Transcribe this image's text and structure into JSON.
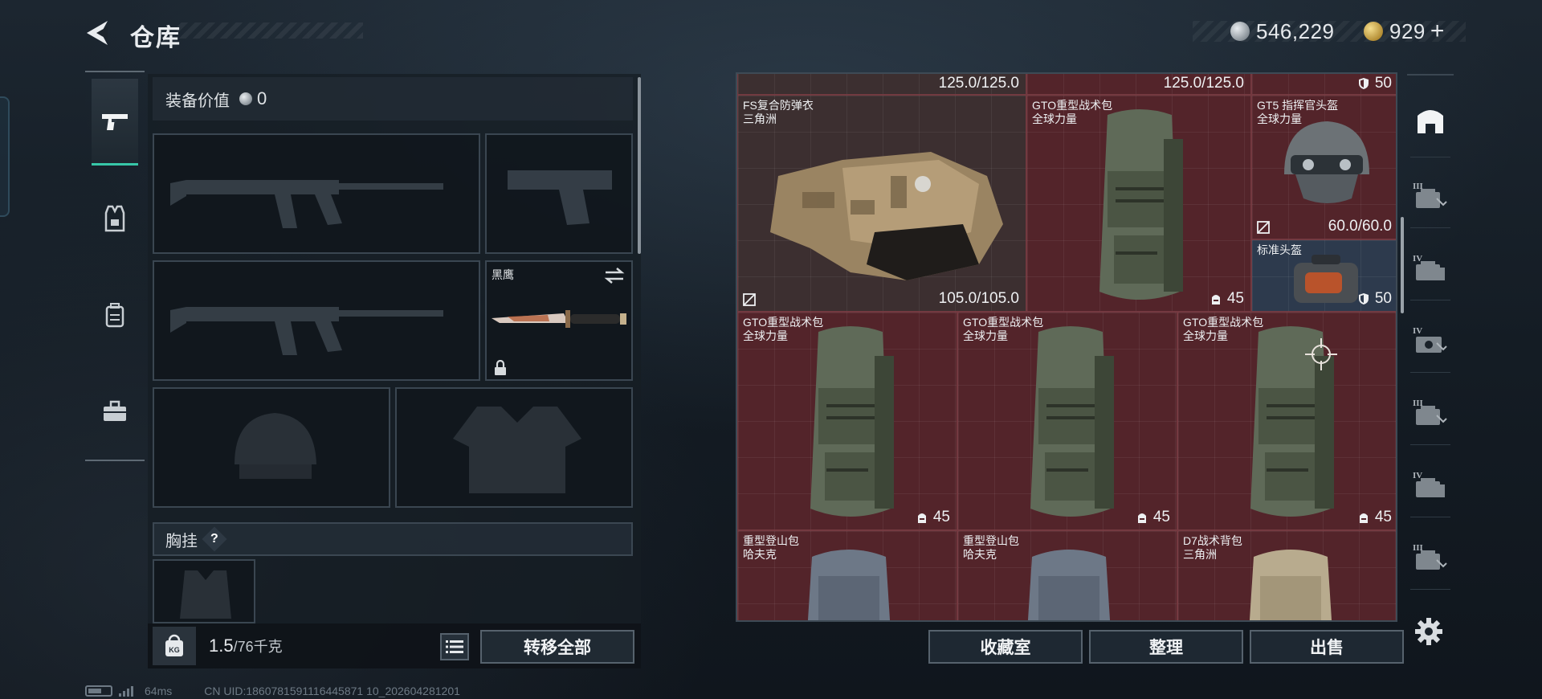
{
  "header": {
    "title": "仓库"
  },
  "currency": {
    "silver_amount": "546,229",
    "gold_amount": "929",
    "gold_add": "+"
  },
  "equipment": {
    "value_label": "装备价值",
    "value": "0",
    "knife_slot": {
      "name": "黑鹰"
    },
    "chest_rig_label": "胸挂",
    "help": "?"
  },
  "weight": {
    "current": "1.5",
    "max": "/76千克",
    "icon_label": "KG"
  },
  "actions": {
    "transfer_all": "转移全部",
    "collection_room": "收藏室",
    "organize": "整理",
    "sell": "出售"
  },
  "storage": {
    "top_row": {
      "left_value": "125.0/125.0",
      "right_value": "125.0/125.0",
      "armor_value": "50"
    },
    "items": [
      {
        "name": "FS复合防弹衣",
        "sub": "三角洲",
        "value": "105.0/105.0",
        "icon": "no-repair-icon"
      },
      {
        "name": "GTO重型战术包",
        "sub": "全球力量",
        "value": "45",
        "icon": "capacity-icon"
      },
      {
        "name": "GT5 指挥官头盔",
        "sub": "全球力量",
        "value": "60.0/60.0",
        "icon": "no-repair-icon"
      },
      {
        "name": "标准头盔",
        "sub": "",
        "value": "50",
        "icon": "shield-icon"
      },
      {
        "name": "GTO重型战术包",
        "sub": "全球力量",
        "value": "45",
        "icon": "capacity-icon"
      },
      {
        "name": "GTO重型战术包",
        "sub": "全球力量",
        "value": "45",
        "icon": "capacity-icon"
      },
      {
        "name": "GTO重型战术包",
        "sub": "全球力量",
        "value": "45",
        "icon": "capacity-icon"
      },
      {
        "name": "重型登山包",
        "sub": "哈夫克",
        "value": "",
        "icon": ""
      },
      {
        "name": "重型登山包",
        "sub": "哈夫克",
        "value": "",
        "icon": ""
      },
      {
        "name": "D7战术背包",
        "sub": "三角洲",
        "value": "",
        "icon": ""
      }
    ]
  },
  "right_rail": {
    "tabs": [
      "III",
      "IV",
      "IV",
      "III",
      "IV",
      "III"
    ]
  },
  "status": {
    "ping": "64ms",
    "uid": "CN UID:1860781591116445871 10_202604281201"
  },
  "colors": {
    "accent_teal": "#37c7a8",
    "cell_red": "#53242a",
    "panel_dark": "#161d24"
  }
}
